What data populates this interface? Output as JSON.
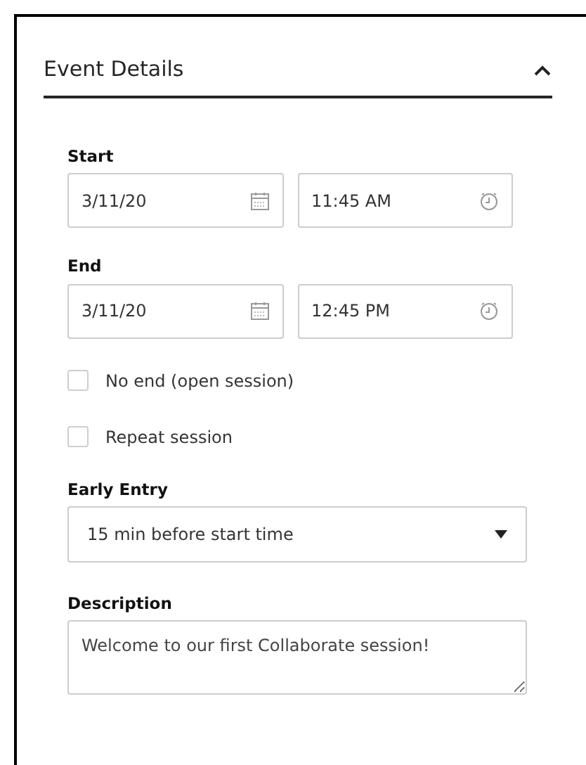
{
  "panel": {
    "title": "Event Details",
    "expanded": true
  },
  "start": {
    "label": "Start",
    "date": "3/11/20",
    "time": "11:45 AM"
  },
  "end": {
    "label": "End",
    "date": "3/11/20",
    "time": "12:45 PM"
  },
  "options": [
    {
      "label": "No end (open session)",
      "checked": false
    },
    {
      "label": "Repeat session",
      "checked": false
    }
  ],
  "early_entry": {
    "label": "Early Entry",
    "value": "15 min before start time"
  },
  "description": {
    "label": "Description",
    "value": "Welcome to our first Collaborate session!"
  }
}
